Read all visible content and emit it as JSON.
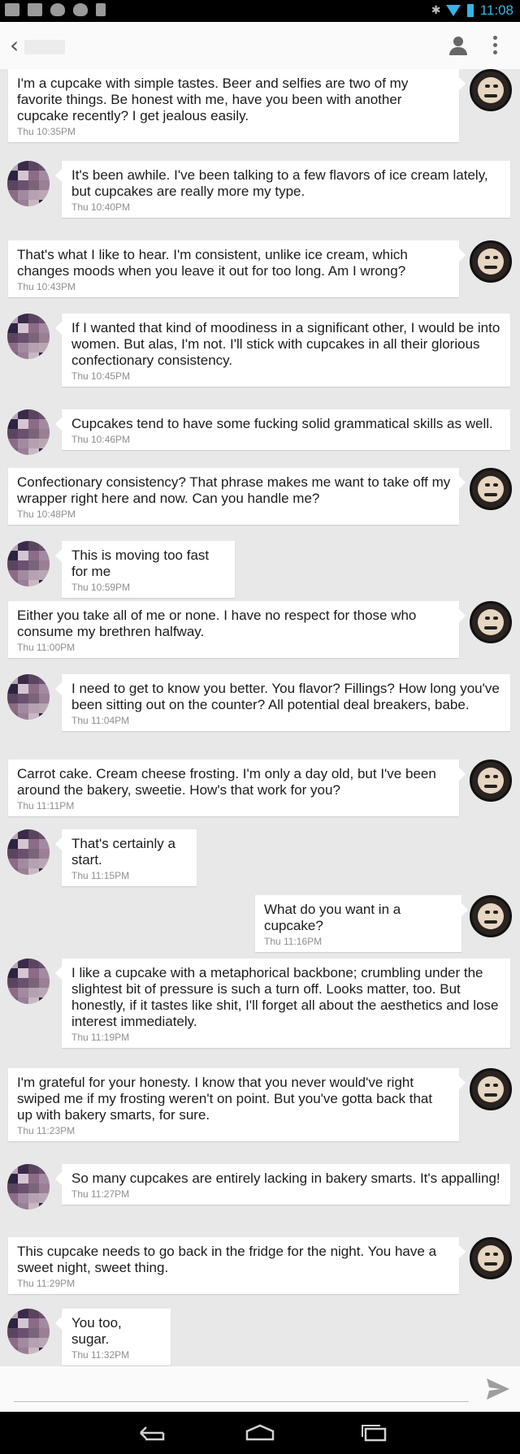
{
  "status_bar": {
    "time": "11:08",
    "icons": [
      "gmail-icon",
      "gallery-icon",
      "tinder-icon",
      "tinder-icon",
      "phone-icon",
      "bluetooth-icon",
      "wifi-icon",
      "battery-icon"
    ],
    "accent": "#33b5e5"
  },
  "header": {
    "back_glyph": "‹"
  },
  "messages": [
    {
      "side": "me",
      "text": "I'm a cupcake with simple tastes. Beer and selfies are two of my favorite things. Be honest with me, have you been with another cupcake recently? I get jealous easily.",
      "time": "Thu 10:35PM"
    },
    {
      "side": "them",
      "text": "It's been awhile. I've been talking to a few flavors of ice cream lately, but cupcakes are really more my type.",
      "time": "Thu 10:40PM"
    },
    {
      "side": "me",
      "text": "That's what I like to hear. I'm consistent, unlike ice cream, which changes moods when you leave it out for too long. Am I wrong?",
      "time": "Thu 10:43PM"
    },
    {
      "side": "them",
      "text": "If I wanted that kind of moodiness in a significant other, I would be into women. But alas, I'm not. I'll stick with cupcakes in all their glorious confectionary consistency.",
      "time": "Thu 10:45PM"
    },
    {
      "side": "them",
      "text": "Cupcakes tend to have some fucking solid grammatical skills as well.",
      "time": "Thu 10:46PM"
    },
    {
      "side": "me",
      "text": "Confectionary consistency? That phrase makes me want to take off my wrapper right here and now. Can you handle me?",
      "time": "Thu 10:48PM"
    },
    {
      "side": "them",
      "text": "This is moving too fast for me",
      "time": "Thu 10:59PM"
    },
    {
      "side": "me",
      "text": "Either you take all of me or none. I have no respect for those who consume my brethren halfway.",
      "time": "Thu 11:00PM"
    },
    {
      "side": "them",
      "text": "I need to get to know you better. You flavor? Fillings? How long you've been sitting out on the counter? All potential deal breakers, babe.",
      "time": "Thu 11:04PM"
    },
    {
      "side": "me",
      "text": "Carrot cake. Cream cheese frosting. I'm only a day old, but I've been around the bakery, sweetie. How's that work for you?",
      "time": "Thu 11:11PM"
    },
    {
      "side": "them",
      "text": "That's certainly a start.",
      "time": "Thu 11:15PM"
    },
    {
      "side": "me",
      "text": "What do you want in a cupcake?",
      "time": "Thu 11:16PM"
    },
    {
      "side": "them",
      "text": "I like a cupcake with a metaphorical backbone; crumbling under the slightest bit of pressure is such a turn off. Looks matter, too. But honestly, if it tastes like shit, I'll forget all about the aesthetics and lose interest immediately.",
      "time": "Thu 11:19PM"
    },
    {
      "side": "me",
      "text": "I'm grateful for your honesty. I know that you never would've right swiped me if my frosting weren't on point. But you've gotta back that up with bakery smarts, for sure.",
      "time": "Thu 11:23PM"
    },
    {
      "side": "them",
      "text": "So many cupcakes are entirely lacking in bakery smarts. It's appalling!",
      "time": "Thu 11:27PM"
    },
    {
      "side": "me",
      "text": "This cupcake needs to go back in the fridge for the night. You have a sweet night, sweet thing.",
      "time": "Thu 11:29PM"
    },
    {
      "side": "them",
      "text": "You too, sugar.",
      "time": "Thu 11:32PM"
    }
  ],
  "compose": {
    "placeholder": ""
  }
}
